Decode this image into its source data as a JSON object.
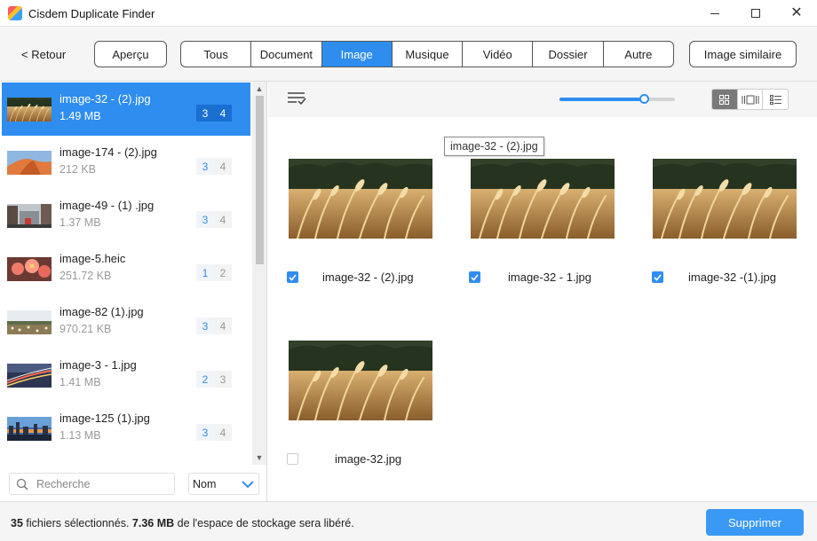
{
  "window": {
    "title": "Cisdem Duplicate Finder"
  },
  "toolbar": {
    "back_label": "< Retour",
    "preview_label": "Aperçu",
    "tabs": [
      {
        "label": "Tous",
        "active": false
      },
      {
        "label": "Document",
        "active": false
      },
      {
        "label": "Image",
        "active": true
      },
      {
        "label": "Musique",
        "active": false
      },
      {
        "label": "Vidéo",
        "active": false
      },
      {
        "label": "Dossier",
        "active": false
      },
      {
        "label": "Autre",
        "active": false
      }
    ],
    "similar_label": "Image similaire"
  },
  "file_list": [
    {
      "name": "image-32 - (2).jpg",
      "size": "1.49 MB",
      "selected_count": "3",
      "total_count": "4",
      "selected": true,
      "thumb": "wheat"
    },
    {
      "name": "image-174 - (2).jpg",
      "size": "212 KB",
      "selected_count": "3",
      "total_count": "4",
      "selected": false,
      "thumb": "dune"
    },
    {
      "name": "image-49 - (1)  .jpg",
      "size": "1.37 MB",
      "selected_count": "3",
      "total_count": "4",
      "selected": false,
      "thumb": "street"
    },
    {
      "name": "image-5.heic",
      "size": "251.72 KB",
      "selected_count": "1",
      "total_count": "2",
      "selected": false,
      "thumb": "flowers"
    },
    {
      "name": "image-82 (1).jpg",
      "size": "970.21 KB",
      "selected_count": "3",
      "total_count": "4",
      "selected": false,
      "thumb": "field"
    },
    {
      "name": "image-3 - 1.jpg",
      "size": "1.41 MB",
      "selected_count": "2",
      "total_count": "3",
      "selected": false,
      "thumb": "night"
    },
    {
      "name": "image-125 (1).jpg",
      "size": "1.13 MB",
      "selected_count": "3",
      "total_count": "4",
      "selected": false,
      "thumb": "city"
    }
  ],
  "search": {
    "placeholder": "Recherche"
  },
  "sort": {
    "value": "Nom"
  },
  "preview": {
    "zoom_level": 0.73,
    "view_mode": "grid",
    "tooltip": "image-32 - (2).jpg",
    "items": [
      {
        "name": "image-32 - (2).jpg",
        "checked": true
      },
      {
        "name": "image-32 - 1.jpg",
        "checked": true
      },
      {
        "name": "image-32 -(1).jpg",
        "checked": true
      },
      {
        "name": "image-32.jpg",
        "checked": false
      }
    ]
  },
  "footer": {
    "count": "35",
    "count_text": "fichiers sélectionnés.",
    "size": "7.36 MB",
    "size_text": "de l'espace de stockage sera libéré.",
    "delete_label": "Supprimer"
  },
  "colors": {
    "accent": "#2f8df0",
    "button": "#3a99f5"
  }
}
